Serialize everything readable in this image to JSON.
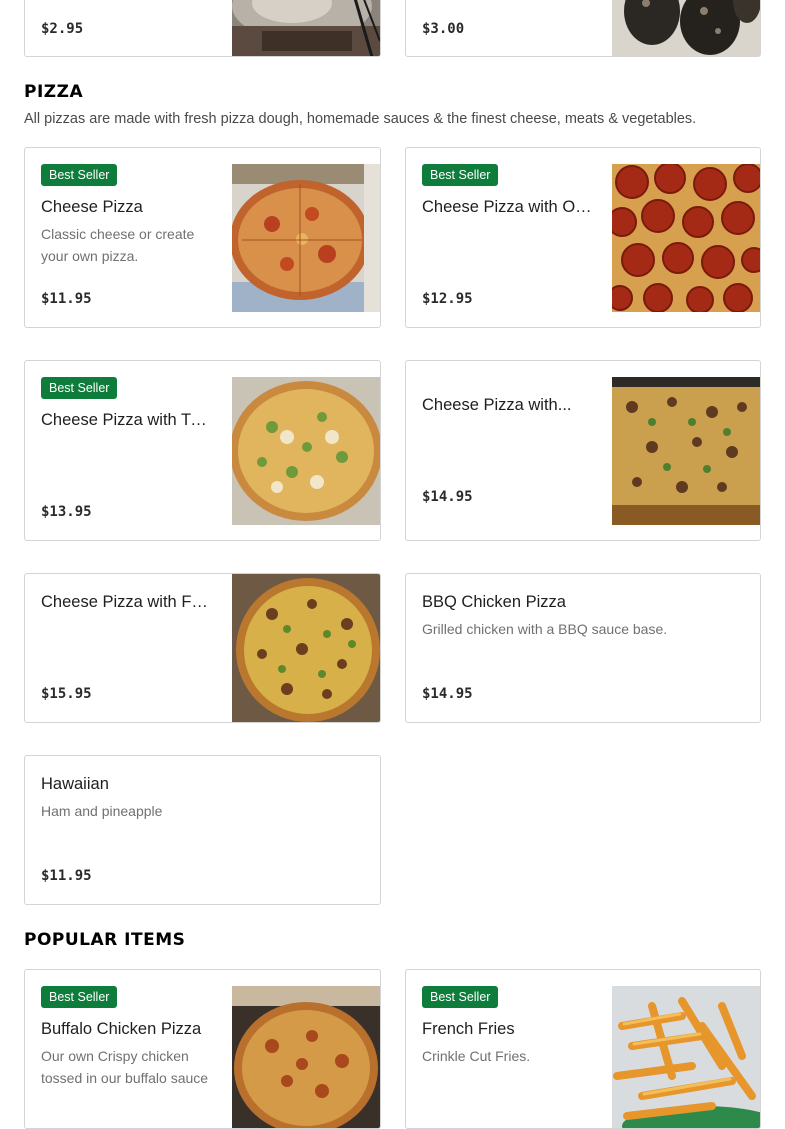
{
  "top_cards": [
    {
      "price": "$2.95"
    },
    {
      "price": "$3.00"
    }
  ],
  "pizza_section": {
    "title": "PIZZA",
    "description": "All pizzas are made with fresh pizza dough, homemade sauces & the finest cheese, meats & vegetables.",
    "items": [
      {
        "badge": "Best Seller",
        "name": "Cheese Pizza",
        "description": "Classic cheese or create your own pizza.",
        "price": "$11.95"
      },
      {
        "badge": "Best Seller",
        "name": "Cheese Pizza with On...",
        "description": "",
        "price": "$12.95"
      },
      {
        "badge": "Best Seller",
        "name": "Cheese Pizza with Tw...",
        "description": "",
        "price": "$13.95"
      },
      {
        "badge": "",
        "name": "Cheese Pizza with...",
        "description": "",
        "price": "$14.95"
      },
      {
        "badge": "",
        "name": "Cheese Pizza with Fo...",
        "description": "",
        "price": "$15.95"
      },
      {
        "badge": "",
        "name": "BBQ Chicken Pizza",
        "description": "Grilled chicken with a BBQ sauce base.",
        "price": "$14.95"
      },
      {
        "badge": "",
        "name": "Hawaiian",
        "description": "Ham and pineapple",
        "price": "$11.95"
      }
    ]
  },
  "popular_section": {
    "title": "POPULAR ITEMS",
    "items": [
      {
        "badge": "Best Seller",
        "name": "Buffalo Chicken Pizza",
        "description": "Our own Crispy chicken tossed in our buffalo sauce"
      },
      {
        "badge": "Best Seller",
        "name": "French Fries",
        "description": "Crinkle Cut Fries."
      }
    ]
  }
}
